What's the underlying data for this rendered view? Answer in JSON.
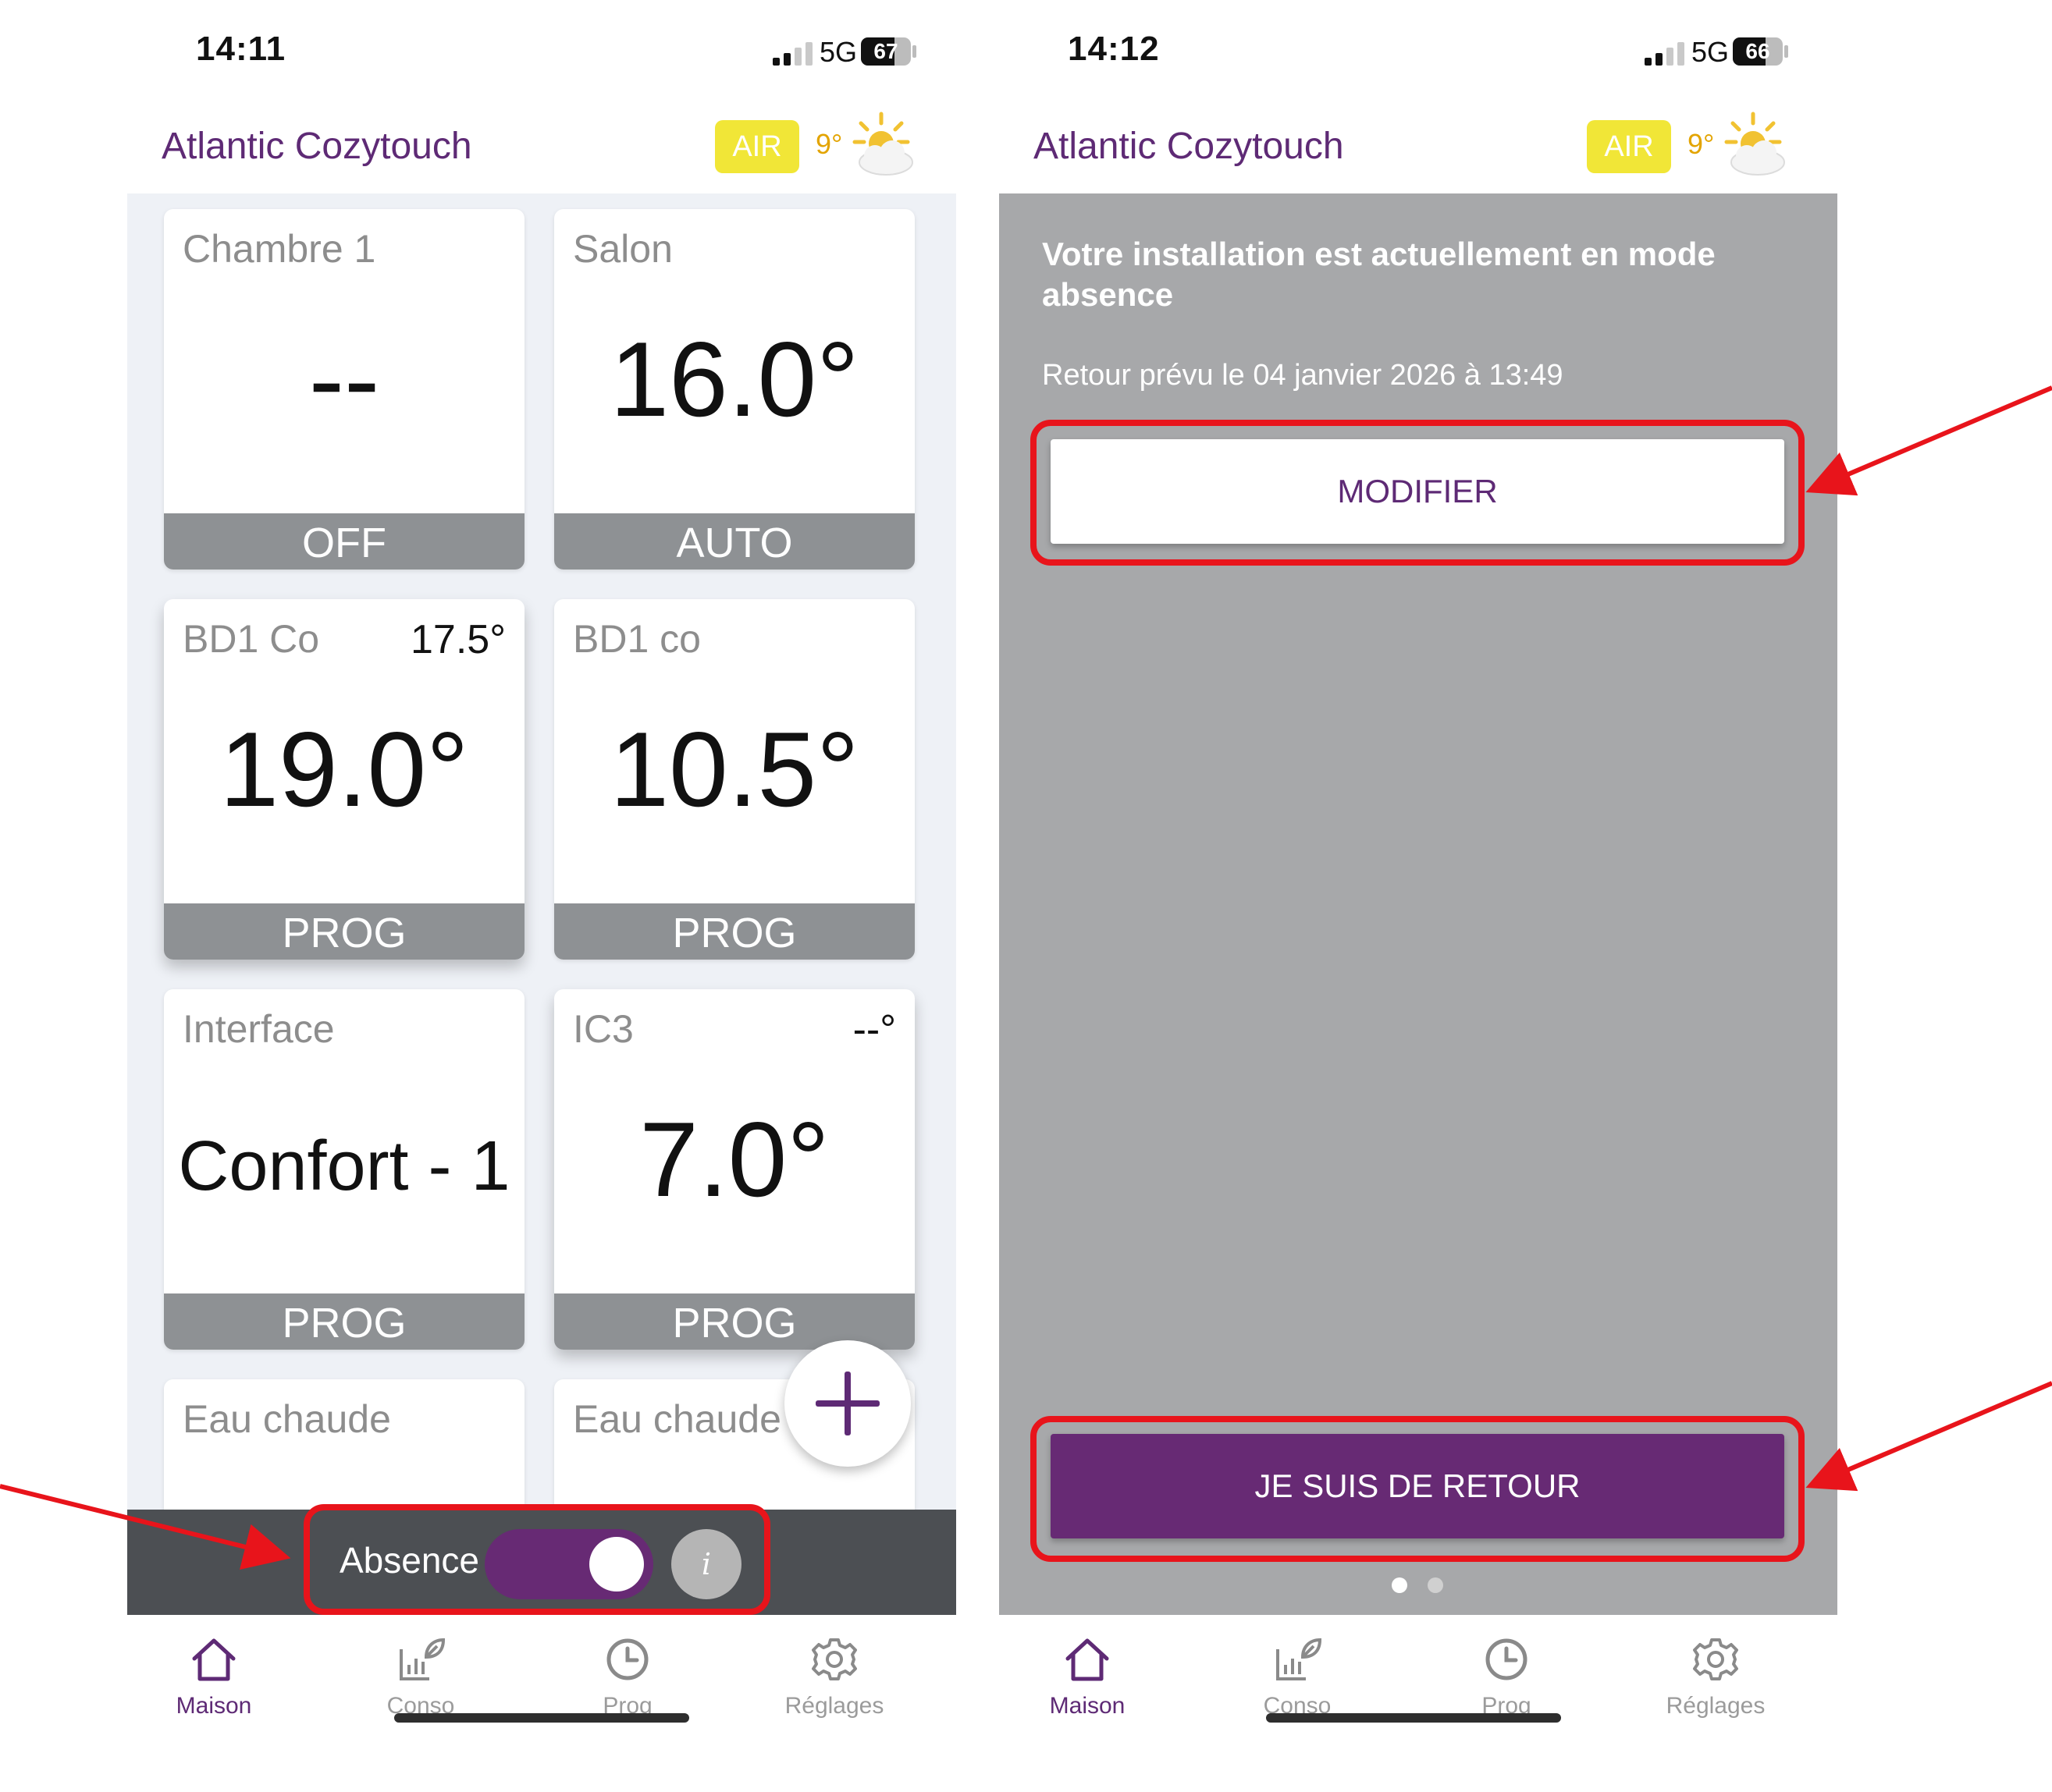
{
  "brand": {
    "title": "Atlantic Cozytouch",
    "accent": "#5e2a75",
    "air_badge": "AIR",
    "outdoor_temp": "9°",
    "weather_icon": "sun-cloud-icon"
  },
  "left_screen": {
    "status": {
      "time": "14:11",
      "network": "5G",
      "battery": "67",
      "battery_fraction": 0.67
    },
    "tiles": [
      {
        "name": "Chambre 1",
        "value": "--",
        "mode": "OFF"
      },
      {
        "name": "Salon",
        "value": "16.0°",
        "mode": "AUTO"
      },
      {
        "name": "BD1 Co",
        "extra": "17.5°",
        "value": "19.0°",
        "mode": "PROG"
      },
      {
        "name": "BD1 co",
        "value": "10.5°",
        "mode": "PROG"
      },
      {
        "name": "Interface",
        "value": "Confort - 1",
        "mode": "PROG"
      },
      {
        "name": "IC3",
        "extra": "--°",
        "value": "7.0°",
        "mode": "PROG"
      },
      {
        "name": "Eau chaude"
      },
      {
        "name": "Eau chaude"
      }
    ],
    "absence_bar": {
      "label": "Absence",
      "toggle_on": true,
      "info": "i"
    }
  },
  "right_screen": {
    "status": {
      "time": "14:12",
      "network": "5G",
      "battery": "66",
      "battery_fraction": 0.66
    },
    "panel": {
      "title": "Votre installation est actuellement en mode absence",
      "return_text": "Retour prévu le 04 janvier 2026 à 13:49",
      "modify_button": "MODIFIER",
      "back_button": "JE SUIS DE RETOUR",
      "page_dots": 2,
      "active_dot": 1
    }
  },
  "tabs": [
    {
      "label": "Maison",
      "icon": "house-icon",
      "active": true
    },
    {
      "label": "Conso",
      "icon": "consumption-chart-icon",
      "active": false
    },
    {
      "label": "Prog",
      "icon": "clock-icon",
      "active": false
    },
    {
      "label": "Réglages",
      "icon": "gear-icon",
      "active": false
    }
  ],
  "colors": {
    "highlight": "#e8141b",
    "tile_mode_bg": "#8e9194",
    "panel_bg": "#a7a8aa",
    "primary_button": "#672a74"
  }
}
